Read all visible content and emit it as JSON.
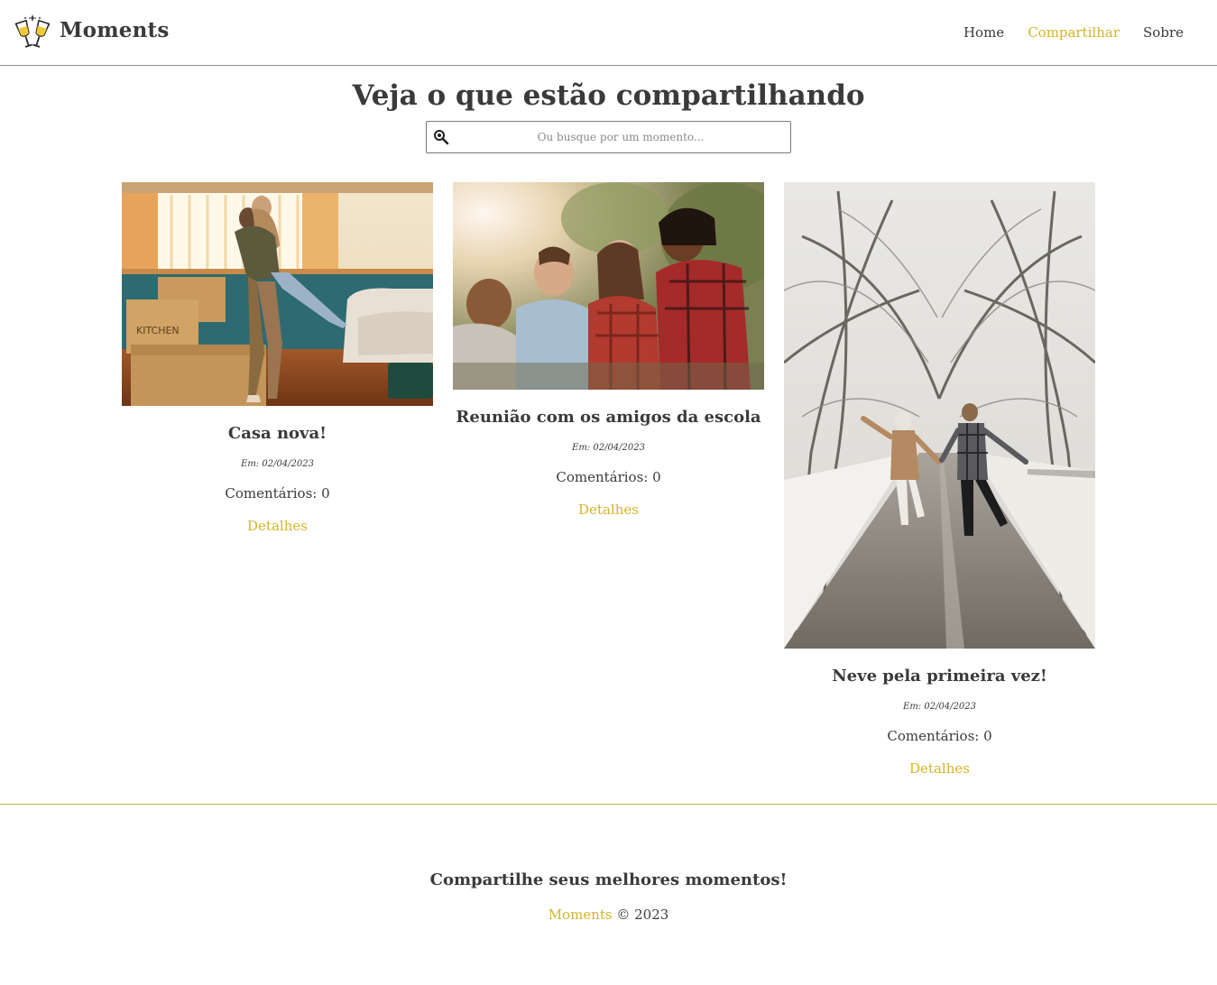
{
  "header": {
    "brand": "Moments",
    "logo_icon": "champagne-toast-icon",
    "nav": [
      {
        "label": "Home",
        "active": false
      },
      {
        "label": "Compartilhar",
        "active": true
      },
      {
        "label": "Sobre",
        "active": false
      }
    ]
  },
  "main": {
    "title": "Veja o que estão compartilhando",
    "search": {
      "placeholder": "Ou busque por um momento...",
      "value": "",
      "icon": "search-icon"
    }
  },
  "moments": [
    {
      "title": "Casa nova!",
      "date": "Em: 02/04/2023",
      "comments": "Comentários: 0",
      "link": "Detalhes",
      "image": "couple-hugging-moving-boxes"
    },
    {
      "title": "Reunião com os amigos da escola",
      "date": "Em: 02/04/2023",
      "comments": "Comentários: 0",
      "link": "Detalhes",
      "image": "friends-laughing-outdoors"
    },
    {
      "title": "Neve pela primeira vez!",
      "date": "Em: 02/04/2023",
      "comments": "Comentários: 0",
      "link": "Detalhes",
      "image": "couple-running-snowy-road"
    }
  ],
  "footer": {
    "tagline": "Compartilhe seus melhores momentos!",
    "brand": "Moments",
    "copyright": "© 2023"
  },
  "colors": {
    "accent": "#d4b42a",
    "text": "#3a3a3a",
    "footer_border": "#c9b24a"
  }
}
